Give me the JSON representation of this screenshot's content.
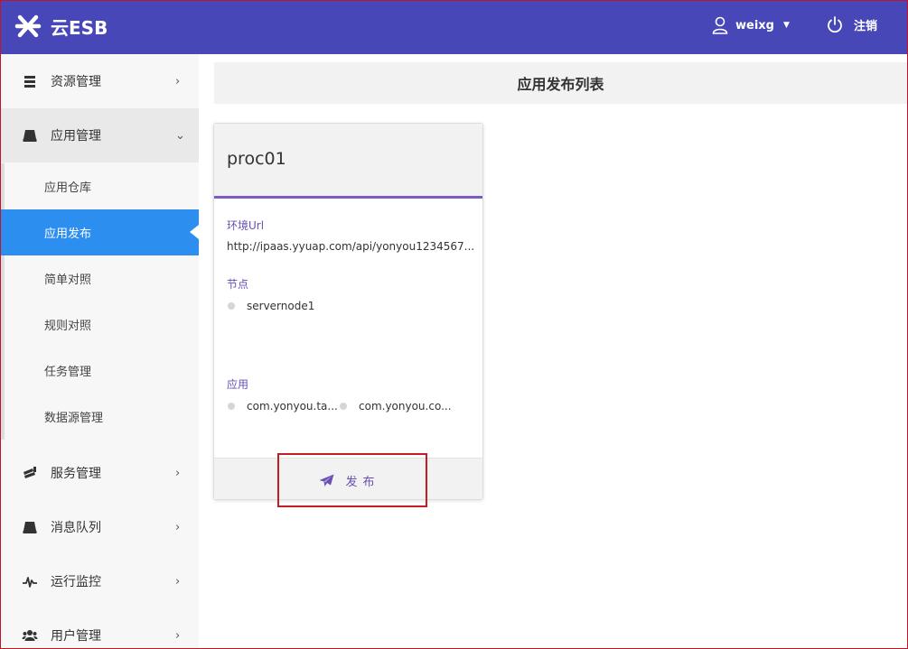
{
  "header": {
    "logo_text": "云ESB",
    "username": "weixg",
    "logout_label": "注销"
  },
  "sidebar": {
    "items": [
      {
        "label": "资源管理",
        "icon": "stack-icon",
        "chevron": "›"
      },
      {
        "label": "应用管理",
        "icon": "drive-icon",
        "chevron": "⌄"
      },
      {
        "label": "服务管理",
        "icon": "server-stack-icon",
        "chevron": "›"
      },
      {
        "label": "消息队列",
        "icon": "drive-icon",
        "chevron": "›"
      },
      {
        "label": "运行监控",
        "icon": "pulse-icon",
        "chevron": "›"
      },
      {
        "label": "用户管理",
        "icon": "users-icon",
        "chevron": "›"
      }
    ],
    "sub_items": [
      {
        "label": "应用仓库"
      },
      {
        "label": "应用发布"
      },
      {
        "label": "简单对照"
      },
      {
        "label": "规则对照"
      },
      {
        "label": "任务管理"
      },
      {
        "label": "数据源管理"
      }
    ]
  },
  "main": {
    "title": "应用发布列表",
    "card": {
      "name": "proc01",
      "env_label": "环境Url",
      "env_value": "http://ipaas.yyuap.com/api/yonyou1234567...",
      "node_label": "节点",
      "nodes": [
        "servernode1"
      ],
      "app_label": "应用",
      "apps": [
        "com.yonyou.ta...",
        "com.yonyou.co..."
      ],
      "publish_label": "发布"
    }
  },
  "colors": {
    "header_bg": "#4747b8",
    "accent": "#7a5cc4",
    "active_nav": "#2c8ff0",
    "highlight": "#c21d24"
  }
}
